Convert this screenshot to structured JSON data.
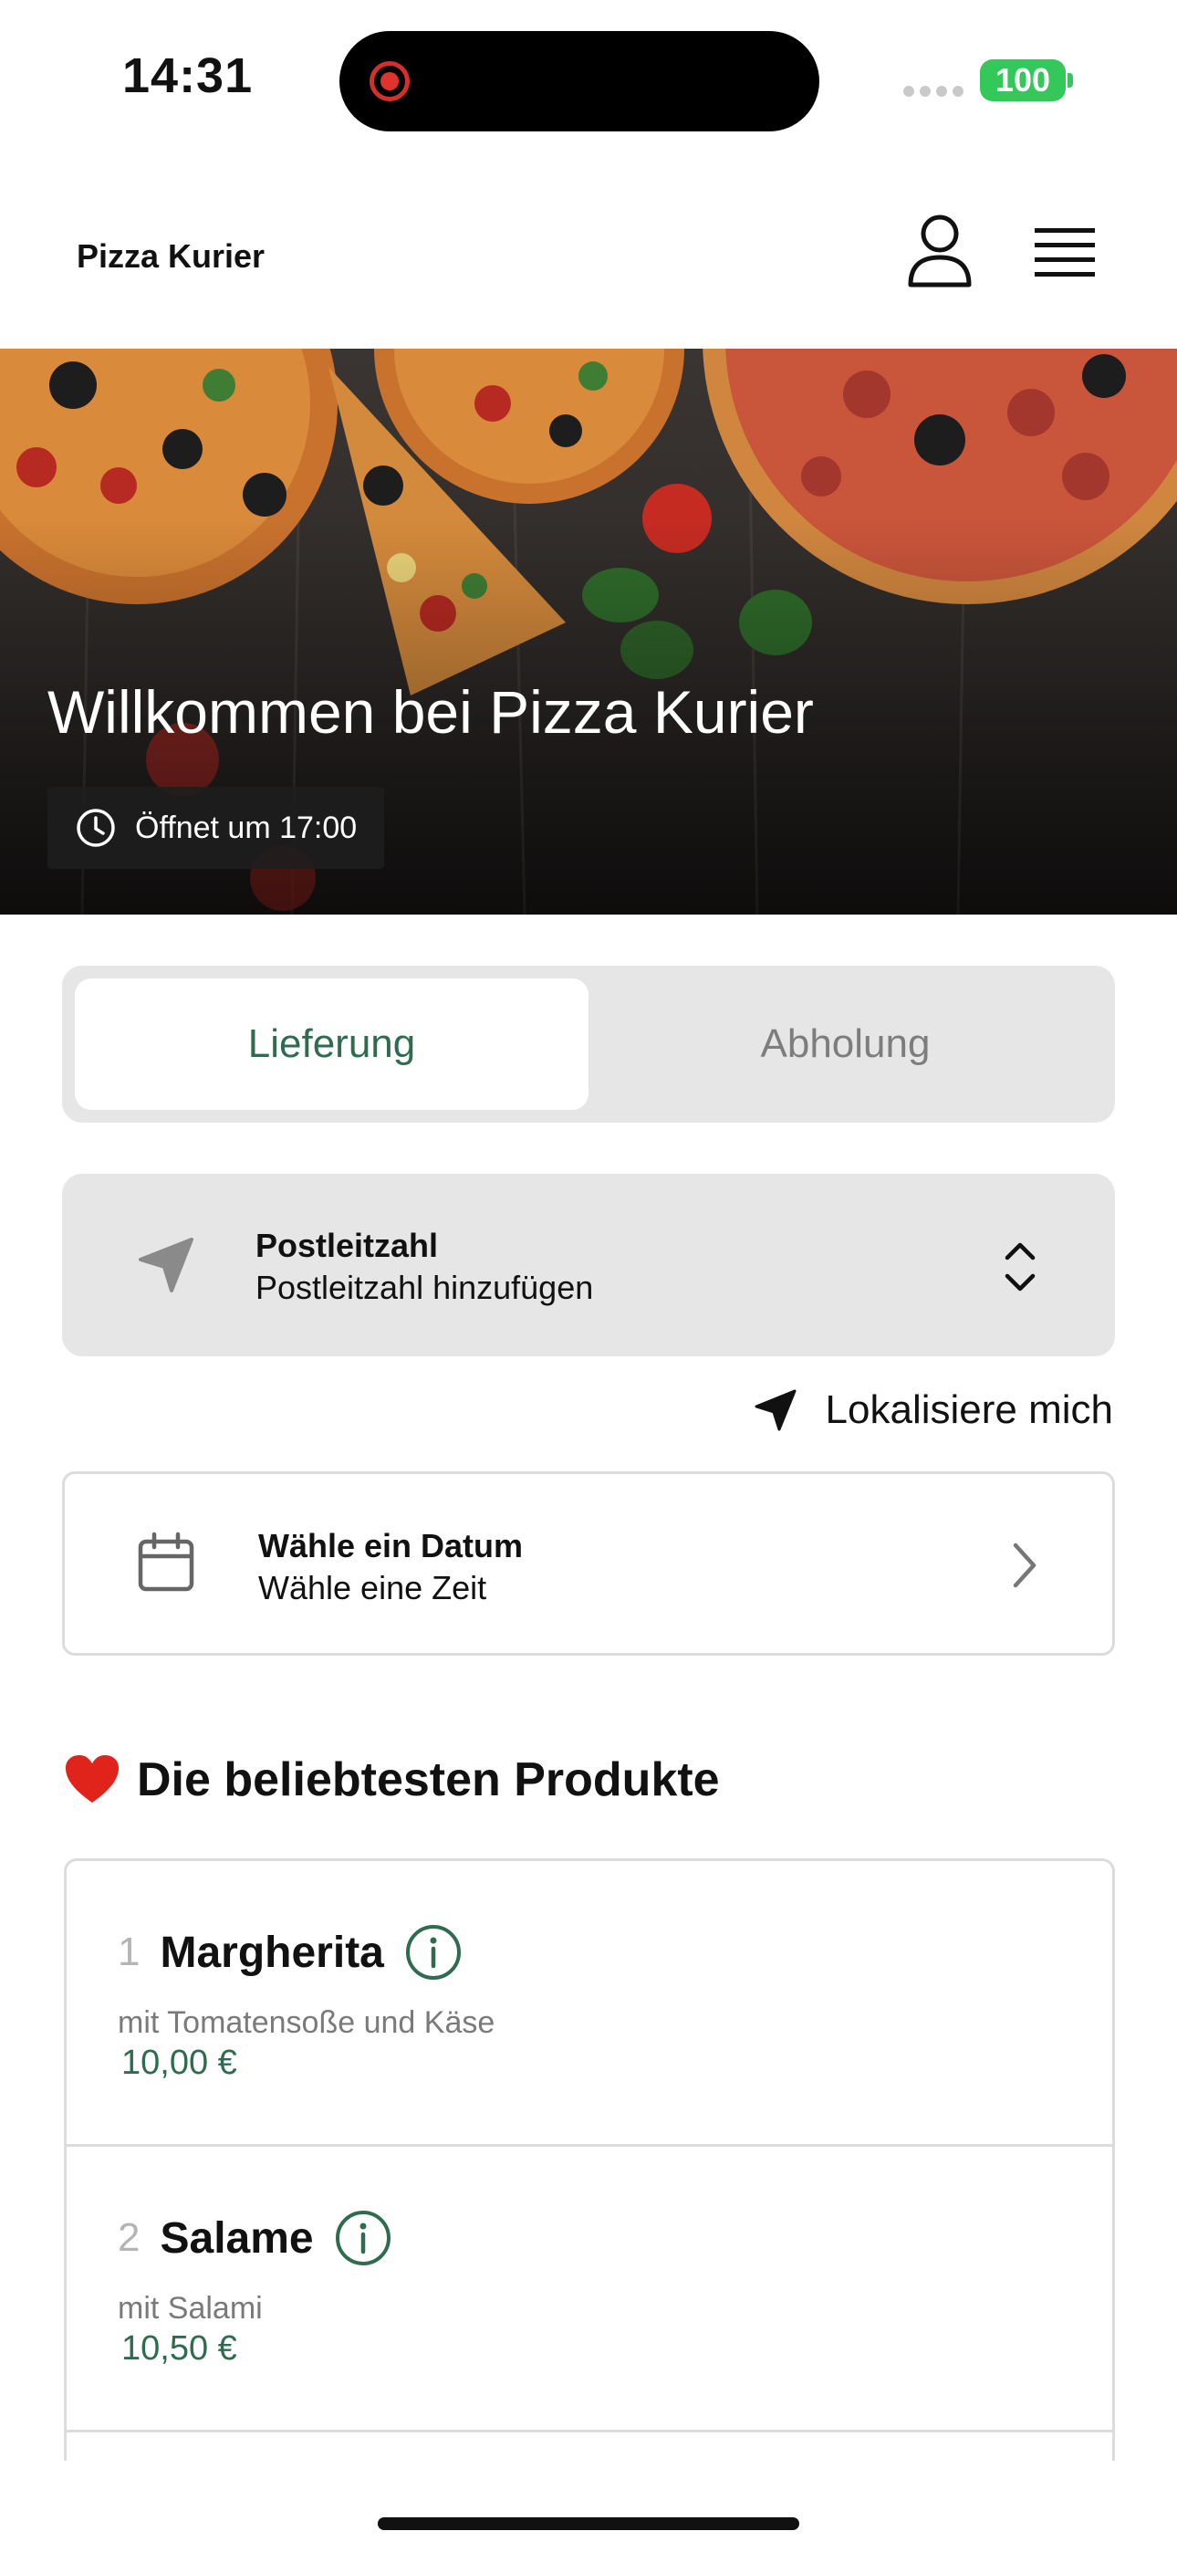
{
  "status_bar": {
    "time": "14:31",
    "battery": "100"
  },
  "header": {
    "brand": "Pizza Kurier"
  },
  "hero": {
    "title": "Willkommen bei Pizza Kurier",
    "hours": "Öffnet um 17:00"
  },
  "mode_toggle": {
    "delivery": "Lieferung",
    "pickup": "Abholung",
    "selected": "delivery"
  },
  "postcode": {
    "title": "Postleitzahl",
    "placeholder": "Postleitzahl hinzufügen"
  },
  "locate": {
    "label": "Lokalisiere mich"
  },
  "date_picker": {
    "title": "Wähle ein Datum",
    "subtitle": "Wähle eine Zeit"
  },
  "popular": {
    "title": "Die beliebtesten Produkte",
    "items": [
      {
        "rank": "1",
        "name": "Margherita",
        "description": "mit Tomatensoße und Käse",
        "price": "10,00 €"
      },
      {
        "rank": "2",
        "name": "Salame",
        "description": "mit Salami",
        "price": "10,50 €"
      }
    ]
  },
  "colors": {
    "accent": "#2f6b4f",
    "battery": "#34c759",
    "card_bg": "#e6e6e6",
    "recording": "#e0332e"
  },
  "icons": [
    "record-icon",
    "user-icon",
    "menu-icon",
    "clock-icon",
    "navigation-arrow-icon",
    "chevron-updown-icon",
    "location-arrow-icon",
    "calendar-icon",
    "chevron-right-icon",
    "heart-icon",
    "info-icon"
  ]
}
